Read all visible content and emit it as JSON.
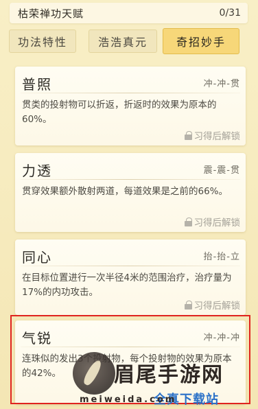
{
  "header": {
    "title": "枯荣禅功天赋",
    "count": "0/31"
  },
  "tabs": [
    {
      "label": "功法特性",
      "active": false
    },
    {
      "label": "浩浩真元",
      "active": false
    },
    {
      "label": "奇招妙手",
      "active": true
    }
  ],
  "cards": [
    {
      "name": "普照",
      "combo": "冲-冲-贯",
      "desc": "贯类的投射物可以折返，折返时的效果为原本的60%。",
      "lock": "习得后解锁"
    },
    {
      "name": "力透",
      "combo": "震-震-贯",
      "desc": "贯穿效果额外散射两道，每道效果是之前的66%。",
      "lock": "习得后解锁"
    },
    {
      "name": "同心",
      "combo": "抬-抬-立",
      "desc": "在目标位置进行一次半径4米的范围治疗，治疗量为17%的内功攻击。",
      "lock": "习得后解锁"
    },
    {
      "name": "气锐",
      "combo": "冲-冲-冲",
      "desc": "连珠似的发出3个投射物，每个投射物的效果为原本的42%。",
      "lock": ""
    }
  ],
  "watermark": {
    "brand": "眉尾手游网",
    "url": "meiweida.com",
    "sub": "全真下载站"
  },
  "colors": {
    "active_tab": "#f7d779",
    "highlight_border": "#e0241f",
    "lock_text": "#a4a198"
  }
}
